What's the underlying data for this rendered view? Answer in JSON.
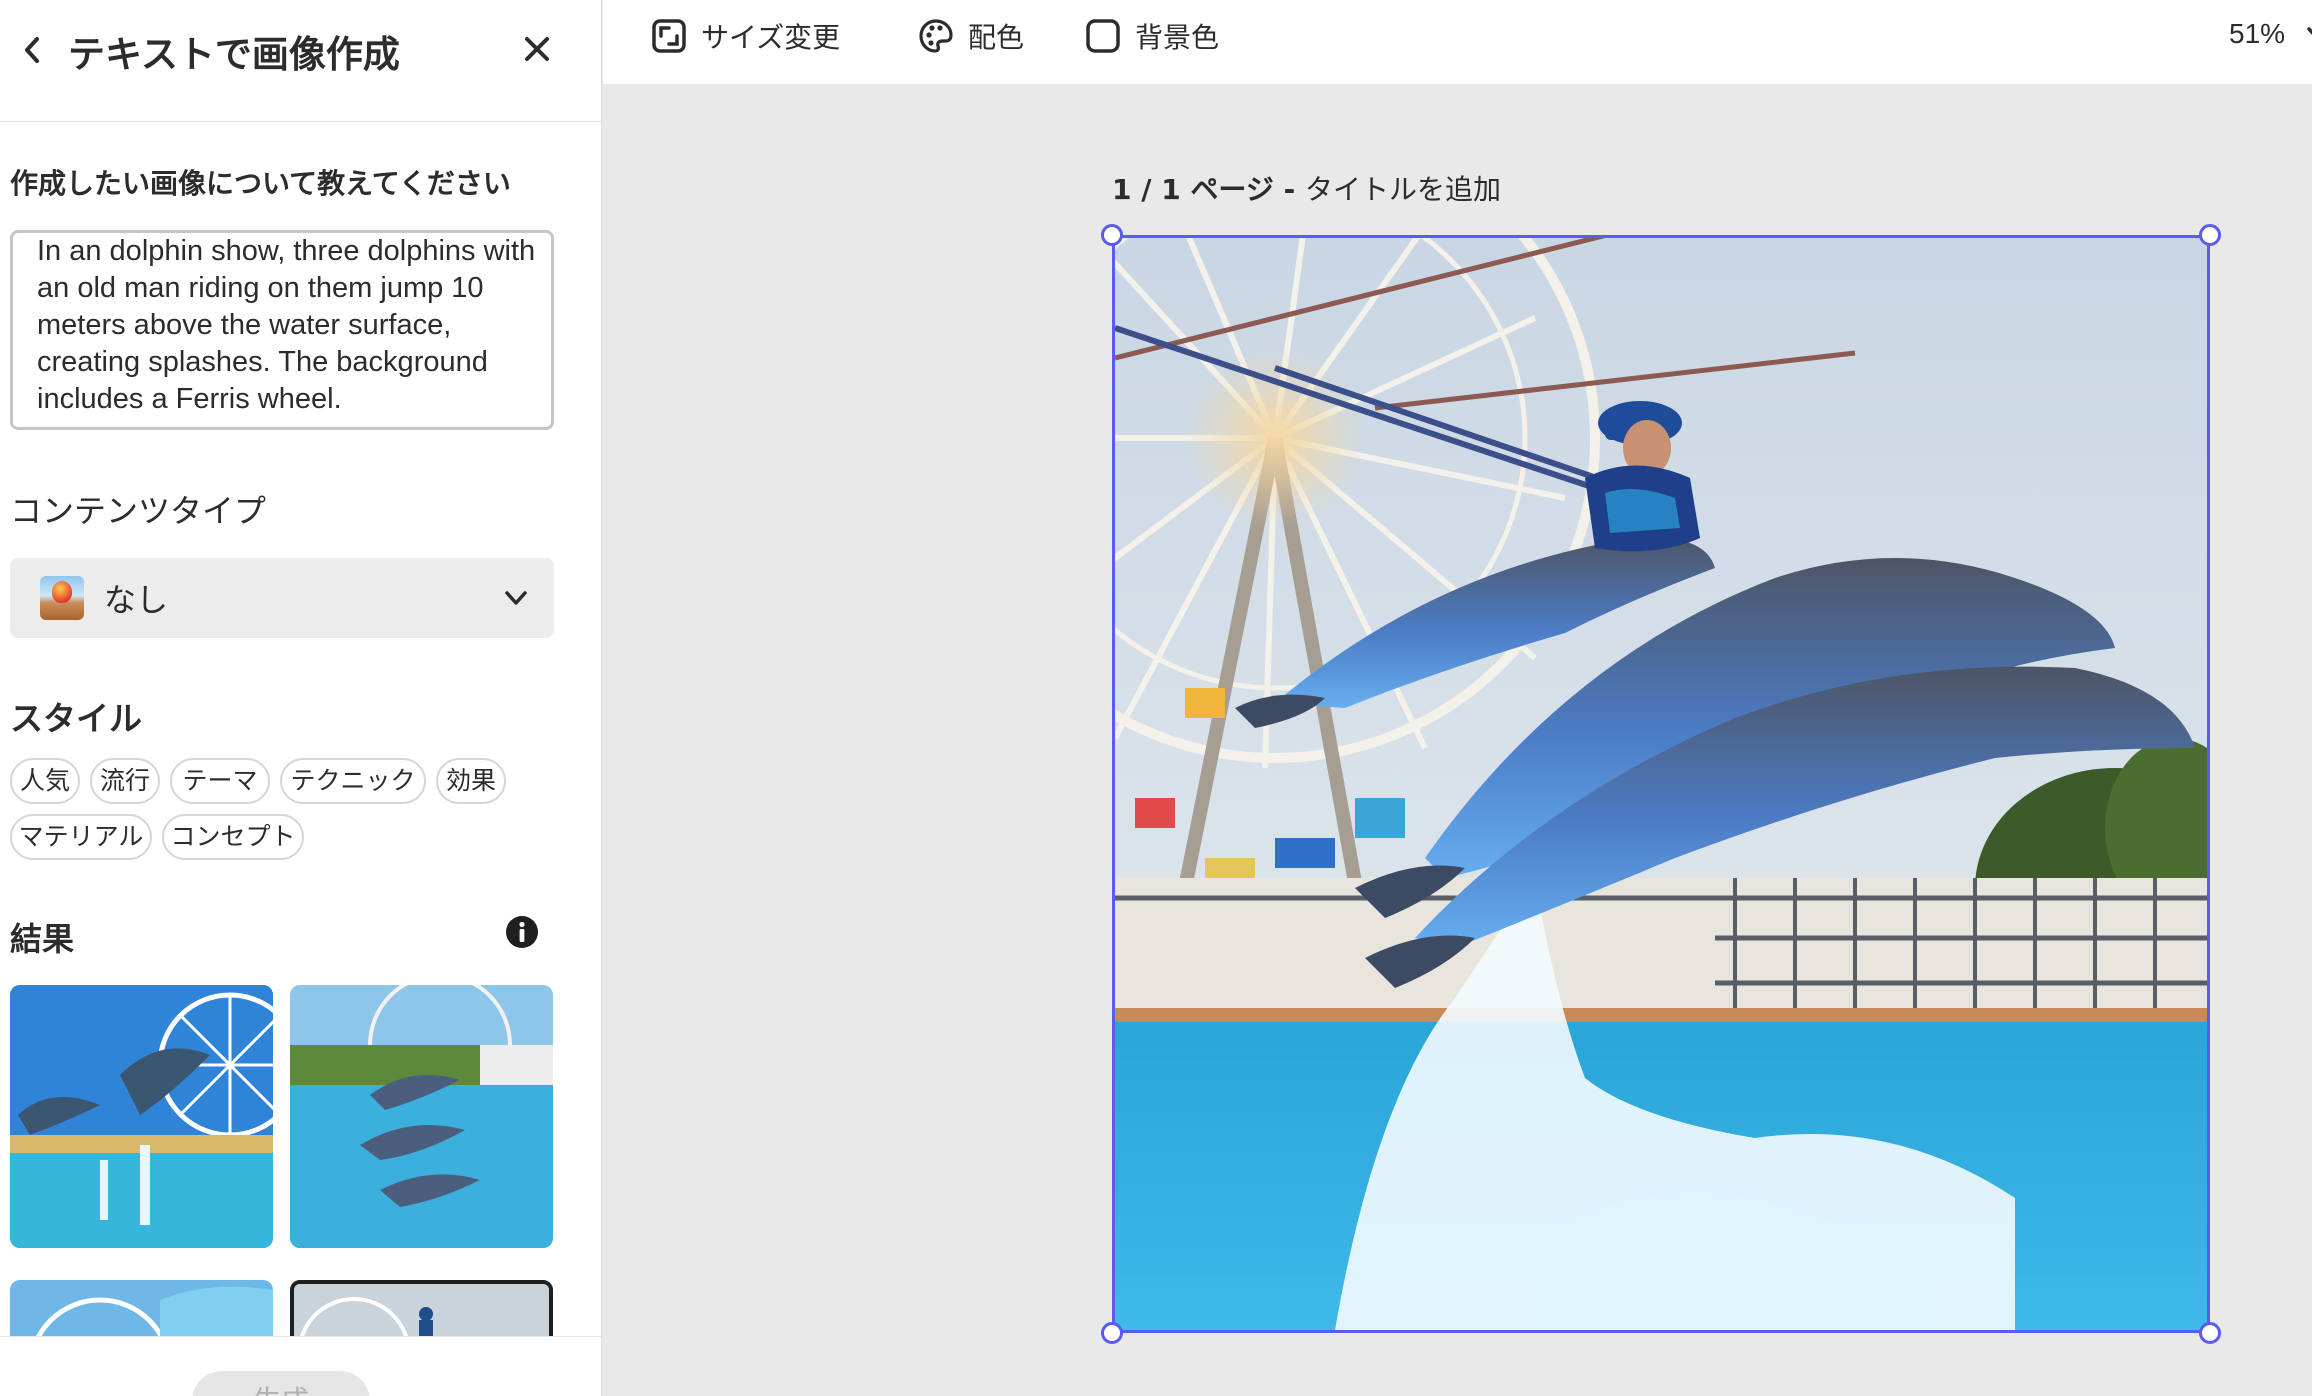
{
  "panel": {
    "title": "テキストで画像作成",
    "prompt_label": "作成したい画像について教えてください",
    "prompt_text": "In an dolphin show, three dolphins with an old man riding on them jump 10 meters above the water surface, creating splashes. The background includes a Ferris wheel.",
    "content_type_label": "コンテンツタイプ",
    "content_type_value": "なし",
    "style_label": "スタイル",
    "style_chips": [
      "人気",
      "流行",
      "テーマ",
      "テクニック",
      "効果",
      "マテリアル",
      "コンセプト"
    ],
    "results_label": "結果",
    "generate_label": "生成"
  },
  "toolbar": {
    "resize_label": "サイズ変更",
    "color_label": "配色",
    "background_label": "背景色",
    "zoom_value": "51%"
  },
  "canvas": {
    "page_counter": "1 / 1 ページ - ",
    "page_title_placeholder": "タイトルを追加"
  },
  "colors": {
    "selection": "#5b5bf0",
    "panel_bg": "#ffffff",
    "canvas_bg": "#e9e9e9"
  },
  "icons": {
    "back": "chevron-left-icon",
    "close": "close-icon",
    "resize": "resize-icon",
    "color": "palette-icon",
    "background": "square-icon",
    "dropdown": "chevron-down-icon",
    "info": "info-icon"
  }
}
